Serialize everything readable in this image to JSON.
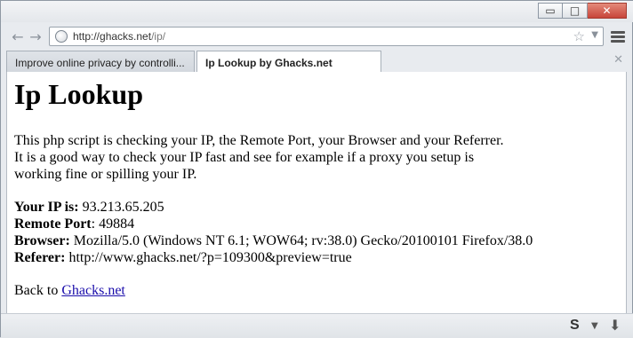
{
  "window": {
    "controls": {
      "minimize": "▭",
      "maximize": "□",
      "close": "✕"
    }
  },
  "navbar": {
    "back_icon": "back-arrow-icon",
    "forward_icon": "forward-arrow-icon",
    "url_host": "http://ghacks.net",
    "url_path": "/ip/",
    "bookmark_icon": "star-icon"
  },
  "tabs": [
    {
      "label": "Improve online privacy by controlli...",
      "active": false
    },
    {
      "label": "Ip Lookup by Ghacks.net",
      "active": true
    }
  ],
  "page": {
    "heading": "Ip Lookup",
    "intro_lines": [
      "This php script is checking your IP, the Remote Port, your Browser and your Referrer.",
      "It is a good way to check your IP fast and see for example if a proxy you setup is",
      "working fine or spilling your IP."
    ],
    "fields": [
      {
        "label": "Your IP is:",
        "value": "93.213.65.205"
      },
      {
        "label": "Remote Port",
        "sep": ":",
        "value": "49884"
      },
      {
        "label": "Browser:",
        "value": "Mozilla/5.0 (Windows NT 6.1; WOW64; rv:38.0) Gecko/20100101 Firefox/38.0"
      },
      {
        "label": "Referer:",
        "value": "http://www.ghacks.net/?p=109300&preview=true"
      }
    ],
    "back_prefix": "Back to",
    "back_link": "Ghacks.net"
  },
  "statusbar": {
    "addon_letter": "S",
    "colors": {
      "link": "#1a0dab"
    }
  }
}
